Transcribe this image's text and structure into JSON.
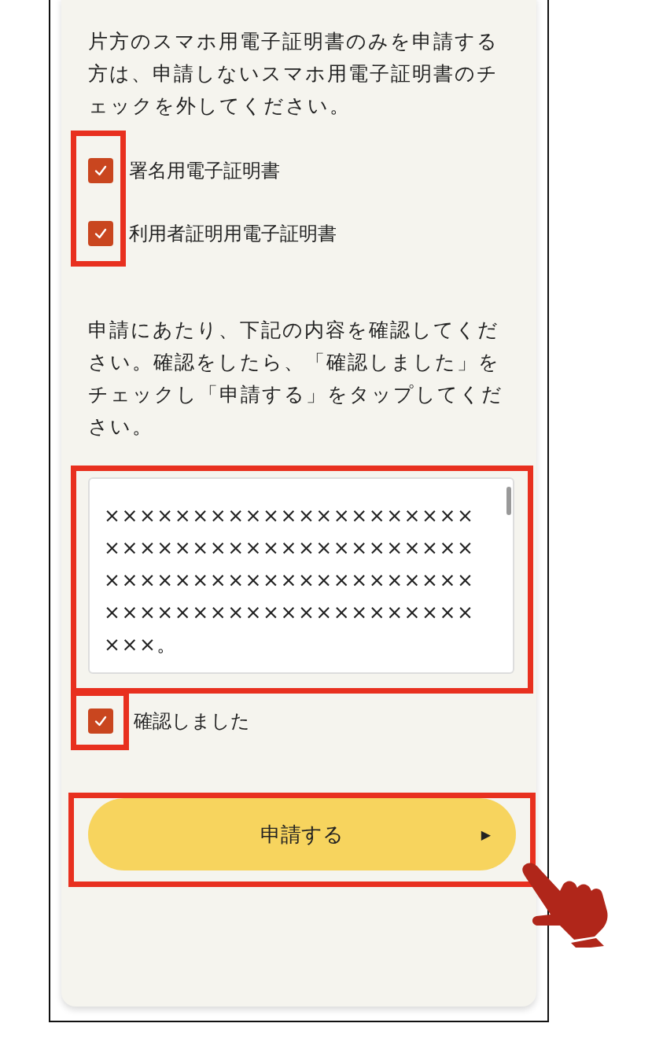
{
  "intro": "片方のスマホ用電子証明書のみを申請する方は、申請しないスマホ用電子証明書のチェックを外してください。",
  "certificates": [
    {
      "label": "署名用電子証明書",
      "checked": true
    },
    {
      "label": "利用者証明用電子証明書",
      "checked": true
    }
  ],
  "instructions": "申請にあたり、下記の内容を確認してください。確認をしたら、「確認しました」をチェックし「申請する」をタップしてください。",
  "terms": {
    "lines": [
      "×××××××××××××××××××××",
      "×××××××××××××××××××××",
      "×××××××××××××××××××××",
      "×××××××××××××××××××××",
      "×××。"
    ]
  },
  "confirm": {
    "label": "確認しました",
    "checked": true
  },
  "submit": {
    "label": "申請する",
    "arrow": "▶"
  }
}
